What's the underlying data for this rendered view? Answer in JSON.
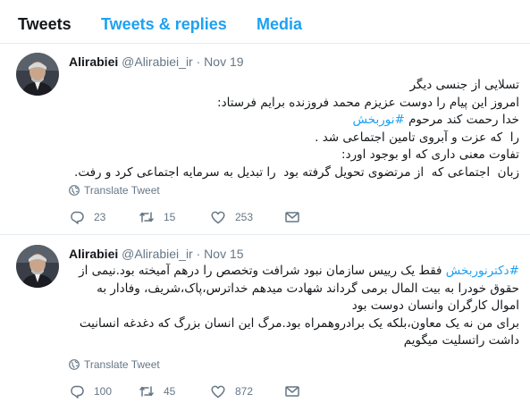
{
  "tabs": [
    {
      "label": "Tweets",
      "active": true
    },
    {
      "label": "Tweets & replies",
      "active": false
    },
    {
      "label": "Media",
      "active": false
    }
  ],
  "colors": {
    "link": "#1da1f2",
    "text": "#14171a",
    "secondary": "#657786",
    "divider": "#e6ecf0"
  },
  "tweets": [
    {
      "name": "Alirabiei",
      "handle": "@Alirabiei_ir",
      "separator": "·",
      "date": "Nov 19",
      "lines": [
        {
          "text": "تسلایی از جنسی دیگر"
        },
        {
          "text": "امروز این پیام را دوست عزیزم محمد فروزنده برایم فرستاد:"
        },
        {
          "prefix": "خدا رحمت کند مرحوم ",
          "hashtag": "#نوربخش"
        },
        {
          "text": "را  که عزت و آبروی تامین اجتماعی شد ."
        },
        {
          "text": "تفاوت معنی داری که او بوجود اورد:"
        },
        {
          "text": "زبان  اجتماعی که  از مرتضوی تحویل گرفته بود  را تبدیل به سرمایه اجتماعی کرد و رفت."
        }
      ],
      "translate_label": "Translate Tweet",
      "replies": "23",
      "retweets": "15",
      "likes": "253"
    },
    {
      "name": "Alirabiei",
      "handle": "@Alirabiei_ir",
      "separator": "·",
      "date": "Nov 15",
      "lines": [
        {
          "hashtag": "#دکترنوربخش",
          "suffix": " فقط یک رییس سازمان نبود شرافت وتخصص را درهم آمیخته بود.نیمی از"
        },
        {
          "text": "حقوق خودرا به بیت المال برمی گرداند شهادت میدهم خداترس،پاک،شریف، وفادار به"
        },
        {
          "text": "اموال کارگران وانسان دوست بود"
        },
        {
          "text": "برای من نه یک معاون،بلکه یک برادروهمراه بود.مرگ این انسان بزرگ که دغدغه انسانیت"
        },
        {
          "text": "داشت راتسلیت میگویم"
        }
      ],
      "translate_label": "Translate Tweet",
      "replies": "100",
      "retweets": "45",
      "likes": "872"
    }
  ],
  "icons": {
    "reply": "reply-icon",
    "retweet": "retweet-icon",
    "like": "heart-icon",
    "dm": "envelope-icon",
    "translate": "globe-icon",
    "avatar": "avatar"
  }
}
